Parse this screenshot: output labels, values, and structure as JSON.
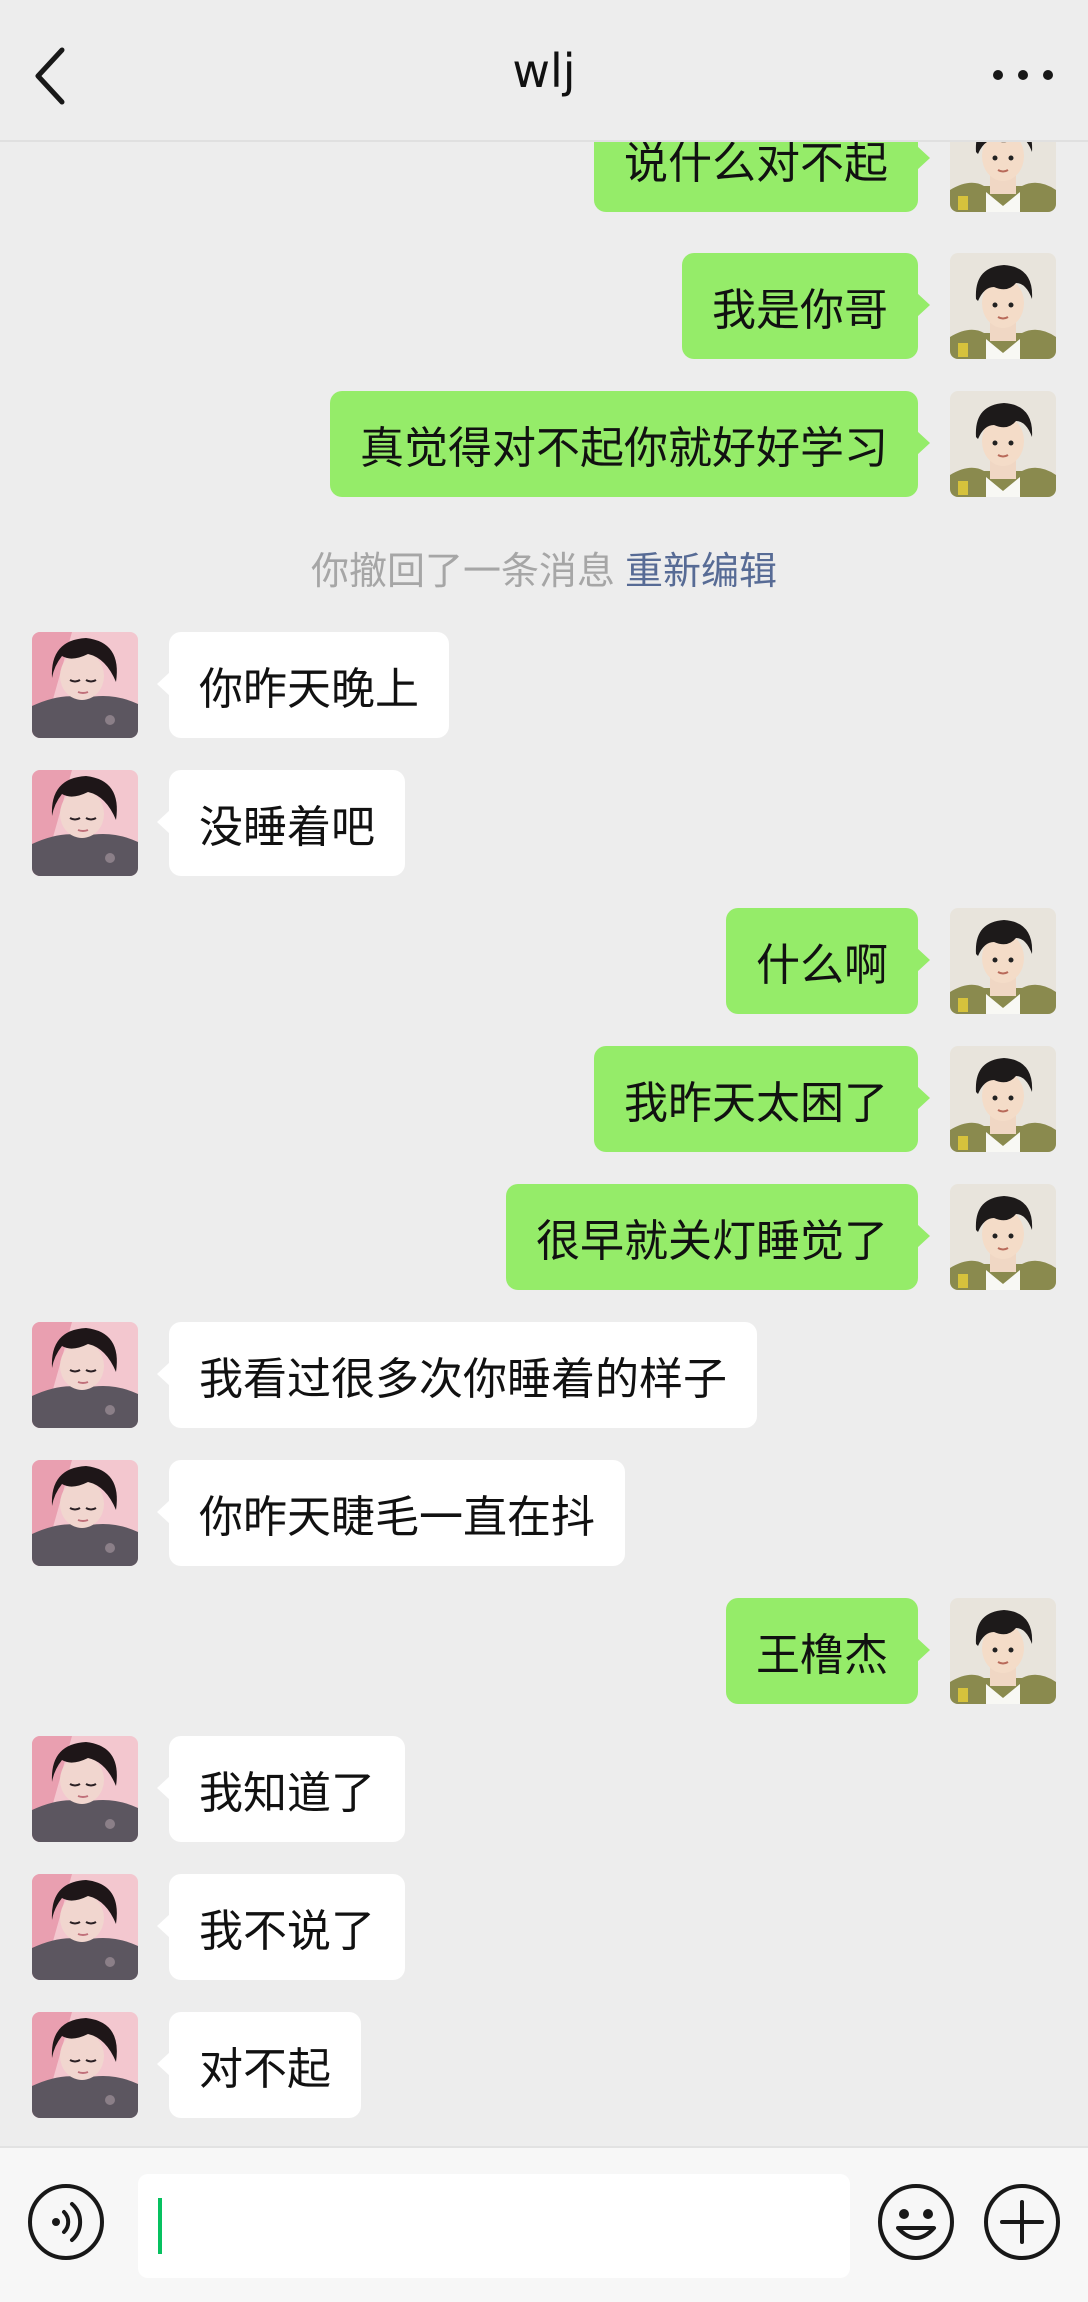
{
  "header": {
    "title": "wlj",
    "back_icon": "chevron-left-icon",
    "more_icon": "more-dots-icon"
  },
  "messages": [
    {
      "side": "me",
      "text": "说什么对不起"
    },
    {
      "side": "me",
      "text": "我是你哥"
    },
    {
      "side": "me",
      "text": "真觉得对不起你就好好学习"
    },
    {
      "side": "system",
      "text": "你撤回了一条消息",
      "link": "重新编辑"
    },
    {
      "side": "them",
      "text": "你昨天晚上"
    },
    {
      "side": "them",
      "text": "没睡着吧"
    },
    {
      "side": "me",
      "text": "什么啊"
    },
    {
      "side": "me",
      "text": "我昨天太困了"
    },
    {
      "side": "me",
      "text": "很早就关灯睡觉了"
    },
    {
      "side": "them",
      "text": "我看过很多次你睡着的样子"
    },
    {
      "side": "them",
      "text": "你昨天睫毛一直在抖"
    },
    {
      "side": "me",
      "text": "王橹杰"
    },
    {
      "side": "them",
      "text": "我知道了"
    },
    {
      "side": "them",
      "text": "我不说了"
    },
    {
      "side": "them",
      "text": "对不起"
    }
  ],
  "input_bar": {
    "value": "",
    "voice_icon": "voice-icon",
    "emoji_icon": "emoji-icon",
    "plus_icon": "plus-icon"
  },
  "colors": {
    "background": "#ededed",
    "my_bubble": "#95ec69",
    "their_bubble": "#ffffff",
    "system_text": "#a6a6a6",
    "system_link": "#576b95",
    "caret": "#07c160"
  }
}
